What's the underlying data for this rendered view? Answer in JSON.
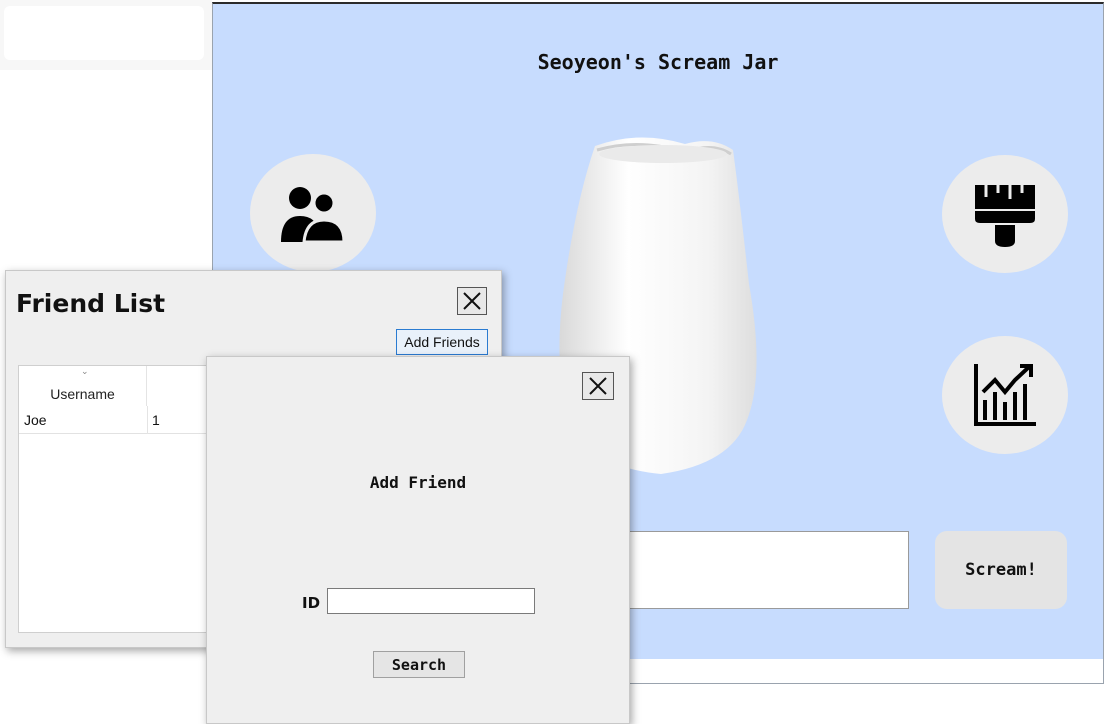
{
  "main": {
    "title": "Seoyeon's Scream Jar",
    "scream_button": "Scream!",
    "scream_input_value": "",
    "icons": [
      "friends-icon",
      "brush-icon",
      "stats-chart-icon"
    ]
  },
  "friend_list": {
    "title": "Friend List",
    "add_friends_button": "Add Friends",
    "columns": [
      "Username",
      ""
    ],
    "rows": [
      {
        "username": "Joe",
        "count": "1"
      }
    ]
  },
  "add_friend": {
    "title": "Add Friend",
    "id_label": "ID",
    "id_value": "",
    "search_button": "Search"
  },
  "colors": {
    "main_background": "#c7dcfe",
    "dialog_background": "#efefef",
    "circle_button": "#ececec"
  }
}
